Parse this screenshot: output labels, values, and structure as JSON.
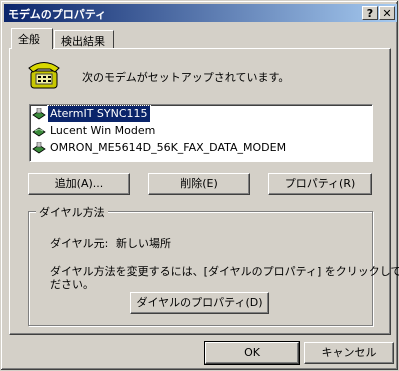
{
  "window": {
    "title": "モデムのプロパティ",
    "help_btn": "?",
    "close_btn": "✕"
  },
  "tabs": [
    {
      "label": "全般",
      "active": true
    },
    {
      "label": "検出結果",
      "active": false
    }
  ],
  "general": {
    "intro_text": "次のモデムがセットアップされています。",
    "modems": [
      {
        "name": "AtermIT SYNC115",
        "selected": true,
        "icon": "modem-icon"
      },
      {
        "name": "Lucent Win Modem",
        "selected": false,
        "icon": "modem-icon"
      },
      {
        "name": "OMRON_ME5614D_56K_FAX_DATA_MODEM",
        "selected": false,
        "icon": "modem-icon"
      }
    ],
    "buttons": {
      "add": "追加(A)...",
      "remove": "削除(E)",
      "properties": "プロパティ(R)"
    }
  },
  "dialing": {
    "group_title": "ダイヤル方法",
    "location_label": "ダイヤル元:",
    "location_value": "新しい場所",
    "description_line1": "ダイヤル方法を変更するには、[ダイヤルのプロパティ] をクリックしてく",
    "description_line2": "ださい。",
    "dialing_properties_button": "ダイヤルのプロパティ(D)"
  },
  "footer": {
    "ok": "OK",
    "cancel": "キャンセル"
  }
}
